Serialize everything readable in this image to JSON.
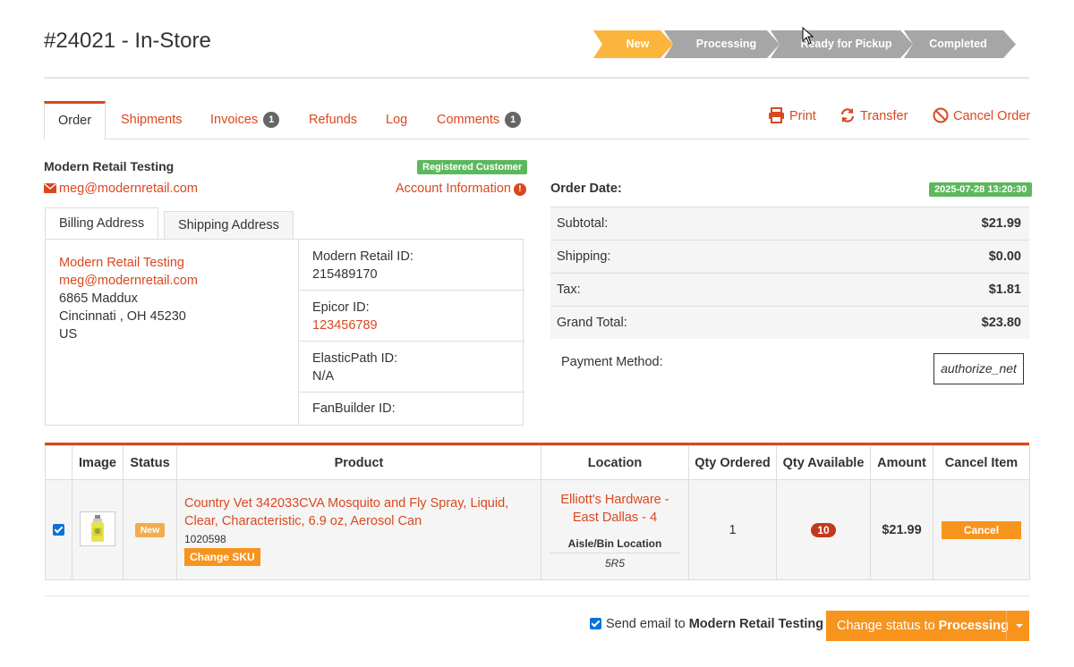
{
  "header": {
    "order_title": "#24021 - In-Store",
    "steps": [
      {
        "label": "New",
        "color": "#fbb43c"
      },
      {
        "label": "Processing",
        "color": "#a6a6a6"
      },
      {
        "label": "Ready for Pickup",
        "color": "#a6a6a6"
      },
      {
        "label": "Completed",
        "color": "#a6a6a6"
      }
    ]
  },
  "tabs": {
    "order": "Order",
    "shipments": "Shipments",
    "invoices": "Invoices",
    "invoices_count": "1",
    "refunds": "Refunds",
    "log": "Log",
    "comments": "Comments",
    "comments_count": "1"
  },
  "actions": {
    "print": "Print",
    "transfer": "Transfer",
    "cancel_order": "Cancel Order"
  },
  "customer": {
    "name": "Modern Retail Testing",
    "badge": "Registered Customer",
    "email": "meg@modernretail.com",
    "account_info": "Account Information",
    "info_icon": "!"
  },
  "address_tabs": {
    "billing": "Billing Address",
    "shipping": "Shipping Address"
  },
  "billing": {
    "name": "Modern Retail Testing",
    "email": "meg@modernretail.com",
    "street": "6865 Maddux",
    "city": "Cincinnati , OH 45230",
    "country": "US"
  },
  "ids": [
    {
      "label": "Modern Retail ID:",
      "value": "215489170",
      "link": false
    },
    {
      "label": "Epicor ID:",
      "value": "123456789",
      "link": true
    },
    {
      "label": "ElasticPath ID:",
      "value": "N/A",
      "link": false
    },
    {
      "label": "FanBuilder ID:",
      "value": "",
      "link": false
    }
  ],
  "summary": {
    "order_date_label": "Order Date:",
    "order_date": "2025-07-28 13:20:30",
    "rows": [
      {
        "label": "Subtotal:",
        "value": "$21.99"
      },
      {
        "label": "Shipping:",
        "value": "$0.00"
      },
      {
        "label": "Tax:",
        "value": "$1.81"
      },
      {
        "label": "Grand Total:",
        "value": "$23.80"
      }
    ],
    "payment_method_label": "Payment Method:",
    "payment_method": "authorize_net"
  },
  "items_table": {
    "headers": [
      "",
      "Image",
      "Status",
      "Product",
      "Location",
      "Qty Ordered",
      "Qty Available",
      "Amount",
      "Cancel Item"
    ],
    "rows": [
      {
        "checked": true,
        "status": "New",
        "product_name": "Country Vet 342033CVA Mosquito and Fly Spray, Liquid, Clear, Characteristic, 6.9 oz, Aerosol Can",
        "sku": "1020598",
        "change_sku": "Change SKU",
        "location": "Elliott's Hardware - East Dallas - 4",
        "bin_label": "Aisle/Bin Location",
        "bin": "5R5",
        "qty_ordered": "1",
        "qty_available": "10",
        "amount": "$21.99",
        "cancel": "Cancel"
      }
    ]
  },
  "footer": {
    "send_email_prefix": "Send email to ",
    "send_email_name": "Modern Retail Testing",
    "status_prefix": "Change status to ",
    "status_target": "Processing"
  },
  "colors": {
    "accent": "#d9481f",
    "orange_button": "#f7941d",
    "success": "#5cb85c"
  }
}
